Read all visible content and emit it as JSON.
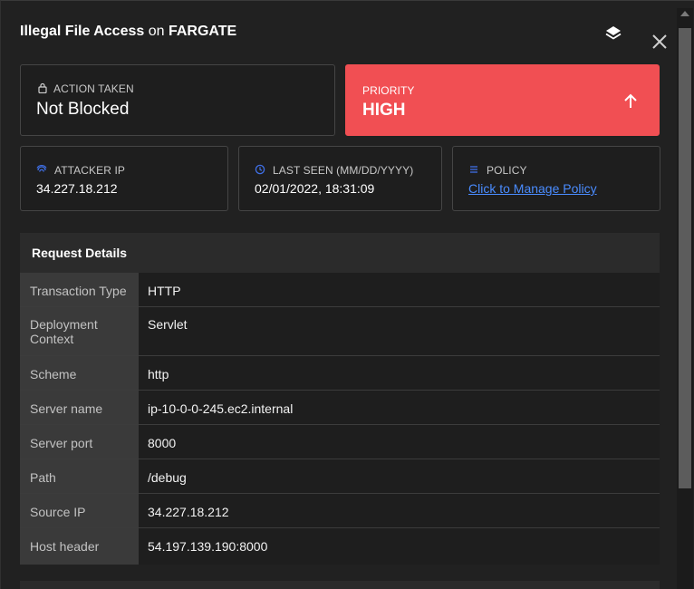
{
  "header": {
    "title_event": "Illegal File Access",
    "title_on": "on",
    "title_app": "FARGATE",
    "layers_icon": "layers-icon",
    "close_icon": "close-icon"
  },
  "action_card": {
    "label": "ACTION TAKEN",
    "value": "Not Blocked",
    "icon": "lock-icon"
  },
  "priority_card": {
    "label": "PRIORITY",
    "value": "HIGH",
    "icon": "arrow-up-icon",
    "color": "#f14f53"
  },
  "attacker_card": {
    "label": "ATTACKER IP",
    "value": "34.227.18.212",
    "icon": "fingerprint-icon"
  },
  "last_seen_card": {
    "label": "LAST SEEN (MM/DD/YYYY)",
    "value": "02/01/2022, 18:31:09",
    "icon": "clock-icon"
  },
  "policy_card": {
    "label": "POLICY",
    "link": "Click to Manage Policy",
    "icon": "list-icon",
    "link_color": "#4a8cff"
  },
  "request_details": {
    "title": "Request Details",
    "rows": [
      {
        "key": "Transaction Type",
        "value": "HTTP"
      },
      {
        "key": "Deployment Context",
        "value": "Servlet"
      },
      {
        "key": "Scheme",
        "value": "http"
      },
      {
        "key": "Server name",
        "value": "ip-10-0-0-245.ec2.internal"
      },
      {
        "key": "Server port",
        "value": "8000"
      },
      {
        "key": "Path",
        "value": "/debug"
      },
      {
        "key": "Source IP",
        "value": "34.227.18.212"
      },
      {
        "key": "Host header",
        "value": "54.197.139.190:8000"
      }
    ]
  }
}
